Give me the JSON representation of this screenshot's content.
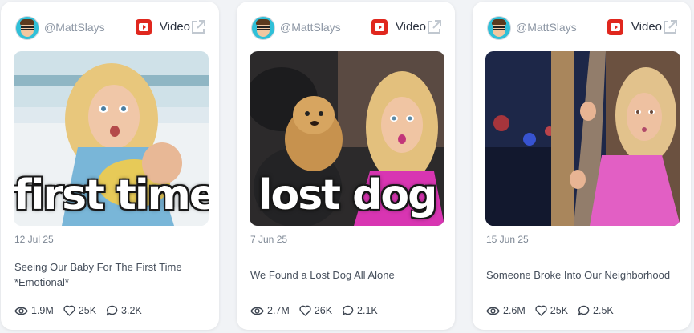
{
  "cards": [
    {
      "handle": "@MattSlays",
      "type": "Video",
      "thumb_text": "first time",
      "date": "12 Jul 25",
      "title": "Seeing Our Baby For The First Time *Emotional*",
      "views": "1.9M",
      "likes": "25K",
      "comments": "3.2K"
    },
    {
      "handle": "@MattSlays",
      "type": "Video",
      "thumb_text": "lost dog",
      "date": "7 Jun 25",
      "title": "We Found a Lost Dog All Alone",
      "views": "2.7M",
      "likes": "26K",
      "comments": "2.1K"
    },
    {
      "handle": "@MattSlays",
      "type": "Video",
      "thumb_text": "",
      "date": "15 Jun 25",
      "title": "Someone Broke Into Our Neighborhood",
      "views": "2.6M",
      "likes": "25K",
      "comments": "2.5K"
    }
  ],
  "colors": {
    "background": "#f1f3f6",
    "card": "#ffffff",
    "youtube_red": "#e0271e",
    "muted_text": "#8b95a3"
  },
  "icons": [
    "avatar",
    "youtube-icon",
    "external-link-icon",
    "eye-icon",
    "heart-icon",
    "comment-icon"
  ]
}
